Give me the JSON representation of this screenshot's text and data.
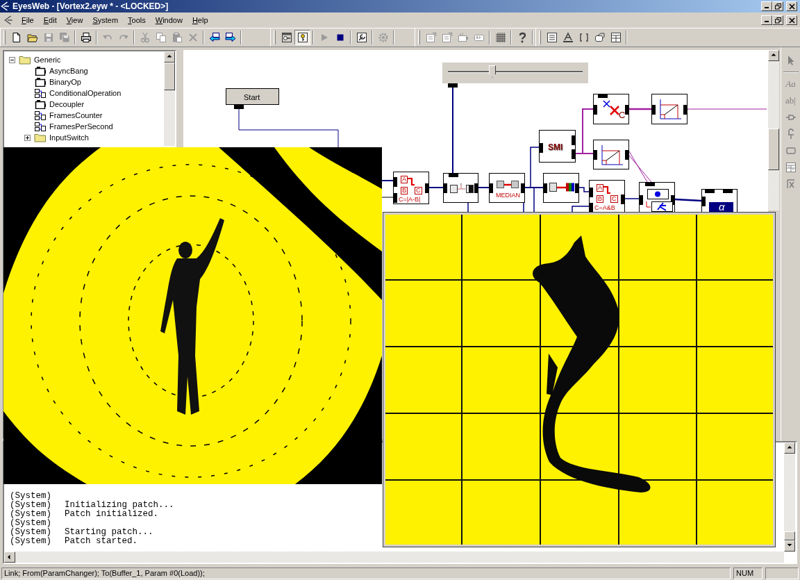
{
  "window": {
    "title": "EyesWeb - [Vortex2.eyw * - <LOCKED>]"
  },
  "menu": [
    "File",
    "Edit",
    "View",
    "System",
    "Tools",
    "Window",
    "Help"
  ],
  "toolbars": [
    [
      [
        {
          "kind": "new",
          "disabled": false,
          "pressed": false
        },
        {
          "kind": "open",
          "disabled": false,
          "pressed": false
        },
        {
          "kind": "save",
          "disabled": true,
          "pressed": false
        },
        {
          "kind": "saveall",
          "disabled": true,
          "pressed": false
        }
      ],
      [
        {
          "kind": "print",
          "disabled": false,
          "pressed": false
        }
      ],
      [
        {
          "kind": "undo",
          "disabled": true,
          "pressed": false
        },
        {
          "kind": "redo",
          "disabled": true,
          "pressed": false
        }
      ],
      [
        {
          "kind": "cut",
          "disabled": true,
          "pressed": false
        },
        {
          "kind": "copy",
          "disabled": true,
          "pressed": false
        },
        {
          "kind": "paste",
          "disabled": true,
          "pressed": false
        },
        {
          "kind": "delete",
          "disabled": true,
          "pressed": false
        }
      ],
      [
        {
          "kind": "back",
          "disabled": false,
          "pressed": false
        },
        {
          "kind": "forward",
          "disabled": false,
          "pressed": false
        }
      ]
    ],
    [
      [
        {
          "kind": "design",
          "disabled": false,
          "pressed": false
        },
        {
          "kind": "lock",
          "disabled": false,
          "pressed": true
        }
      ],
      [
        {
          "kind": "play",
          "disabled": true,
          "pressed": false
        },
        {
          "kind": "stop",
          "disabled": false,
          "pressed": false
        }
      ],
      [
        {
          "kind": "wrench",
          "disabled": false,
          "pressed": false
        }
      ],
      [
        {
          "kind": "gear",
          "disabled": true,
          "pressed": false
        }
      ]
    ],
    [
      [
        {
          "kind": "props",
          "disabled": true,
          "pressed": false
        },
        {
          "kind": "props",
          "disabled": true,
          "pressed": false
        },
        {
          "kind": "camera",
          "disabled": true,
          "pressed": false
        },
        {
          "kind": "tab",
          "disabled": true,
          "pressed": false
        }
      ],
      [
        {
          "kind": "grid",
          "disabled": false,
          "pressed": false
        }
      ],
      [
        {
          "kind": "help",
          "disabled": false,
          "pressed": false
        }
      ]
    ],
    [
      [
        {
          "kind": "textbox",
          "disabled": false,
          "pressed": false
        },
        {
          "kind": "textA",
          "disabled": false,
          "pressed": false
        },
        {
          "kind": "brackets",
          "disabled": false,
          "pressed": false
        },
        {
          "kind": "link",
          "disabled": false,
          "pressed": false
        },
        {
          "kind": "table",
          "disabled": false,
          "pressed": false
        }
      ]
    ]
  ],
  "tree": [
    {
      "label": "Generic",
      "kind": "folder",
      "expanded": true,
      "children": [
        {
          "label": "AsyncBang",
          "kind": "block"
        },
        {
          "label": "BinaryOp",
          "kind": "block"
        },
        {
          "label": "ConditionalOperation",
          "kind": "macro"
        },
        {
          "label": "Decoupler",
          "kind": "block"
        },
        {
          "label": "FramesCounter",
          "kind": "macro"
        },
        {
          "label": "FramesPerSecond",
          "kind": "macro"
        },
        {
          "label": "InputSwitch",
          "kind": "folder",
          "expanded": false
        }
      ]
    }
  ],
  "nodes": [
    {
      "kind": "button",
      "label": "Start"
    },
    {
      "kind": "slider",
      "level": 0.33
    },
    {
      "kind": "logic",
      "inputs": [
        "A",
        "B"
      ],
      "output": "C",
      "formula": "C=|A-B|"
    },
    {
      "kind": "converter"
    },
    {
      "kind": "median",
      "label": "MEDIAN"
    },
    {
      "kind": "text",
      "label": "SMI"
    },
    {
      "kind": "color"
    },
    {
      "kind": "logic",
      "inputs": [
        "A",
        "B"
      ],
      "output": "C",
      "formula": "C=A&B"
    },
    {
      "kind": "cross",
      "label": "C"
    },
    {
      "kind": "ramp"
    },
    {
      "kind": "ramp"
    },
    {
      "kind": "motion"
    },
    {
      "kind": "alpha",
      "label": "α"
    }
  ],
  "palette": [
    {
      "kind": "pointer"
    },
    {
      "kind": "glyph",
      "glyph": "Aa"
    },
    {
      "kind": "glyph",
      "glyph": "ab|"
    },
    {
      "kind": "plug"
    },
    {
      "kind": "pin"
    },
    {
      "kind": "rect"
    },
    {
      "kind": "table"
    },
    {
      "kind": "formula"
    }
  ],
  "log": [
    {
      "source": "(System)"
    },
    {
      "source": "(System)",
      "message": "Initializing patch..."
    },
    {
      "source": "(System)",
      "message": "Patch initialized."
    },
    {
      "source": "(System)"
    },
    {
      "source": "(System)",
      "message": "Starting patch..."
    },
    {
      "source": "(System)",
      "message": "Patch started."
    }
  ],
  "status_bar": {
    "text": "Link; From(ParamChanger); To(Buffer_1, Param #0(Load));",
    "indicator": "NUM"
  }
}
